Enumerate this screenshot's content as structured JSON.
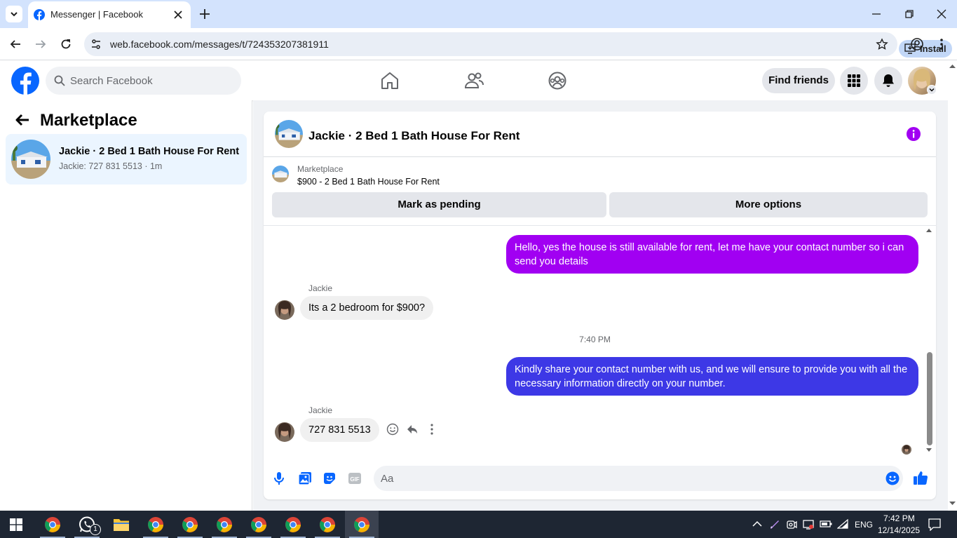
{
  "browser": {
    "tab_title": "Messenger | Facebook",
    "url": "web.facebook.com/messages/t/724353207381911",
    "install_label": "Install"
  },
  "header": {
    "search_placeholder": "Search Facebook",
    "find_friends_label": "Find friends",
    "nav_icons": [
      "home-icon",
      "friends-icon",
      "groups-icon"
    ],
    "right_icons": [
      "menu-grid-icon",
      "notifications-bell-icon",
      "profile-avatar"
    ]
  },
  "sidebar": {
    "title": "Marketplace",
    "conversations": [
      {
        "name": "Jackie · 2 Bed 1 Bath House For Rent",
        "preview": "Jackie: 727 831 5513 · 1m"
      }
    ]
  },
  "chat": {
    "title": "Jackie · 2 Bed 1 Bath House For Rent",
    "listing_source": "Marketplace",
    "listing_title": "$900 - 2 Bed 1 Bath House For Rent",
    "mark_pending_label": "Mark as pending",
    "more_options_label": "More options",
    "timestamp": "7:40 PM",
    "composer_placeholder": "Aa",
    "messages": [
      {
        "direction": "out",
        "text": "Hello, yes the house is still available for rent, let me have your contact number so i can send you  details",
        "color": "#a100f2"
      },
      {
        "direction": "in",
        "sender": "Jackie",
        "text": "Its a 2 bedroom for $900?"
      },
      {
        "direction": "out",
        "text": "Kindly share your contact number with us, and we will ensure to provide you with all the necessary information directly on your number.",
        "color": "#3d38e6"
      },
      {
        "direction": "in",
        "sender": "Jackie",
        "text": "727 831 5513"
      }
    ]
  },
  "taskbar": {
    "time": "7:42 PM",
    "date": "12/14/2025",
    "language": "ENG",
    "whatsapp_badge": "1"
  },
  "colors": {
    "fb_blue": "#0866ff",
    "messenger_purple": "#a100f2",
    "taskbar_bg": "#1e2633"
  }
}
